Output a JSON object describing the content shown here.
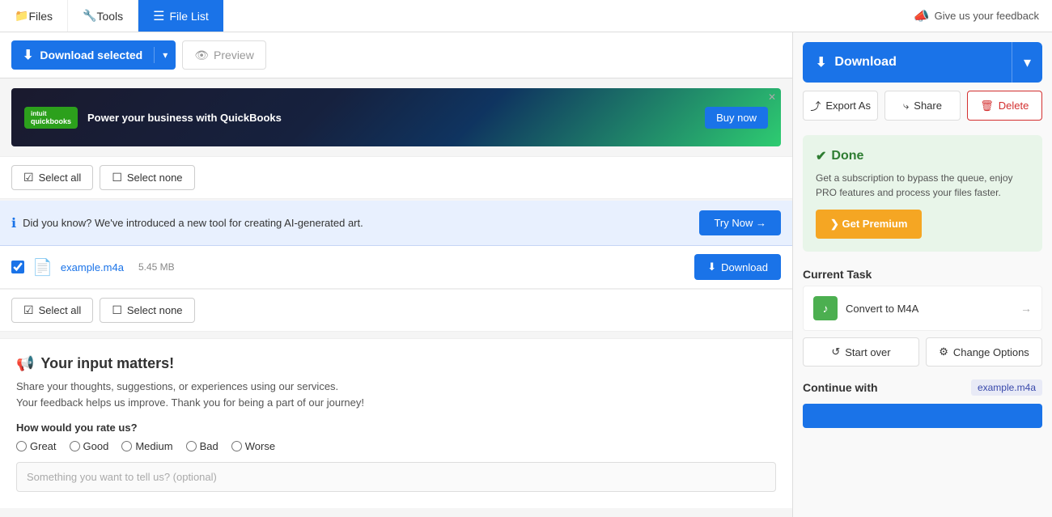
{
  "nav": {
    "items": [
      {
        "label": "Files",
        "icon": "📁",
        "active": false
      },
      {
        "label": "Tools",
        "icon": "🔧",
        "active": false
      },
      {
        "label": "File List",
        "icon": "≡",
        "active": true
      }
    ],
    "feedback_label": "Give us your feedback"
  },
  "toolbar": {
    "download_selected_label": "Download selected",
    "preview_label": "Preview"
  },
  "ad": {
    "logo_text": "intuit quickbooks",
    "main_text": "Power your business with QuickBooks",
    "btn_label": "Buy now"
  },
  "select_top": {
    "select_all_label": "Select all",
    "select_none_label": "Select none"
  },
  "info_banner": {
    "text": "Did you know? We've introduced a new tool for creating AI-generated art.",
    "btn_label": "Try Now →"
  },
  "file": {
    "name": "example.m4a",
    "size": "5.45 MB",
    "download_label": "Download"
  },
  "select_bottom": {
    "select_all_label": "Select all",
    "select_none_label": "Select none"
  },
  "feedback_section": {
    "title": "Your input matters!",
    "icon": "📢",
    "desc1": "Share your thoughts, suggestions, or experiences using our services.",
    "desc2": "Your feedback helps us improve. Thank you for being a part of our journey!",
    "rating_label": "How would you rate us?",
    "options": [
      "Great",
      "Good",
      "Medium",
      "Bad",
      "Worse"
    ],
    "optional_placeholder": "Something you want to tell us? (optional)"
  },
  "right_panel": {
    "download_btn_label": "Download",
    "export_label": "Export As",
    "share_label": "Share",
    "delete_label": "Delete",
    "done": {
      "title": "Done",
      "desc": "Get a subscription to bypass the queue, enjoy PRO features and process your files faster.",
      "premium_btn": "❯ Get Premium"
    },
    "current_task_label": "Current Task",
    "task_name": "Convert to M4A",
    "start_over_label": "Start over",
    "change_options_label": "Change Options",
    "continue_label": "Continue with",
    "continue_file": "example.m4a"
  }
}
